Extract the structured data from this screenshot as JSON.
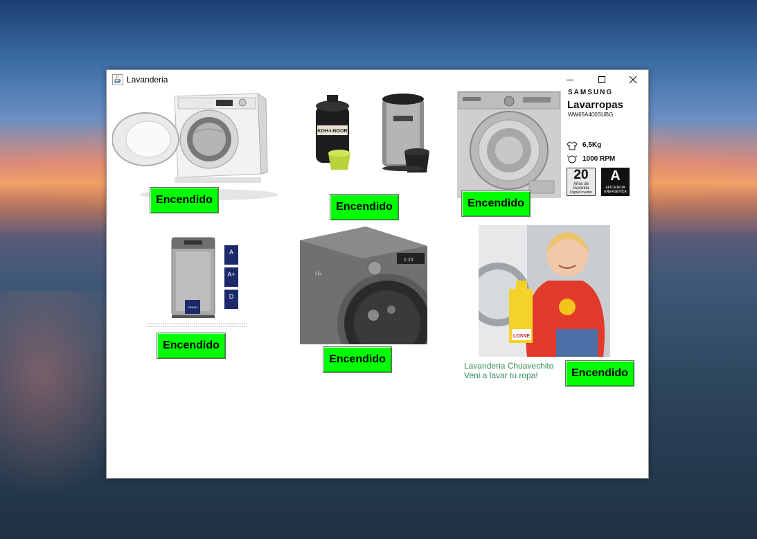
{
  "window": {
    "title": "Lavanderia",
    "controls": {
      "minimize": "minimize-icon",
      "maximize": "maximize-icon",
      "close": "close-icon"
    }
  },
  "products": [
    {
      "name": "front-load-washer-open",
      "button_label": "Encendido"
    },
    {
      "name": "spin-dryers",
      "button_label": "Encendido",
      "brand_text": "KOH-I-NOOR"
    },
    {
      "name": "samsung-washer",
      "button_label": "Encendido"
    },
    {
      "name": "drean-top-load-washer",
      "button_label": "Encendido",
      "brand_text": "DREAN"
    },
    {
      "name": "lg-washer",
      "button_label": "Encendido",
      "brand_text": "LG"
    },
    {
      "name": "boy-with-detergent",
      "button_label": "Encendido",
      "brand_text": "LOSNE"
    }
  ],
  "samsung_ad": {
    "brand": "SAMSUNG",
    "product": "Lavarropas",
    "model": "WW65A400SUBG",
    "capacity": "6,5Kg",
    "speed": "1000 RPM",
    "warranty_years": "20",
    "warranty_text_1": "Años de",
    "warranty_text_2": "Garantía",
    "warranty_text_3": "Digital Inverter",
    "energy_class": "A",
    "energy_text_1": "EFICIENCIA",
    "energy_text_2": "ENERGÉTICA"
  },
  "drean_labels": [
    "A",
    "A+",
    "D"
  ],
  "caption": {
    "line1": "Lavanderia Chuavechito",
    "line2": "Veni a lavar tu ropa!"
  },
  "colors": {
    "button_green": "#00ff00",
    "caption_green": "#2e8b57"
  }
}
